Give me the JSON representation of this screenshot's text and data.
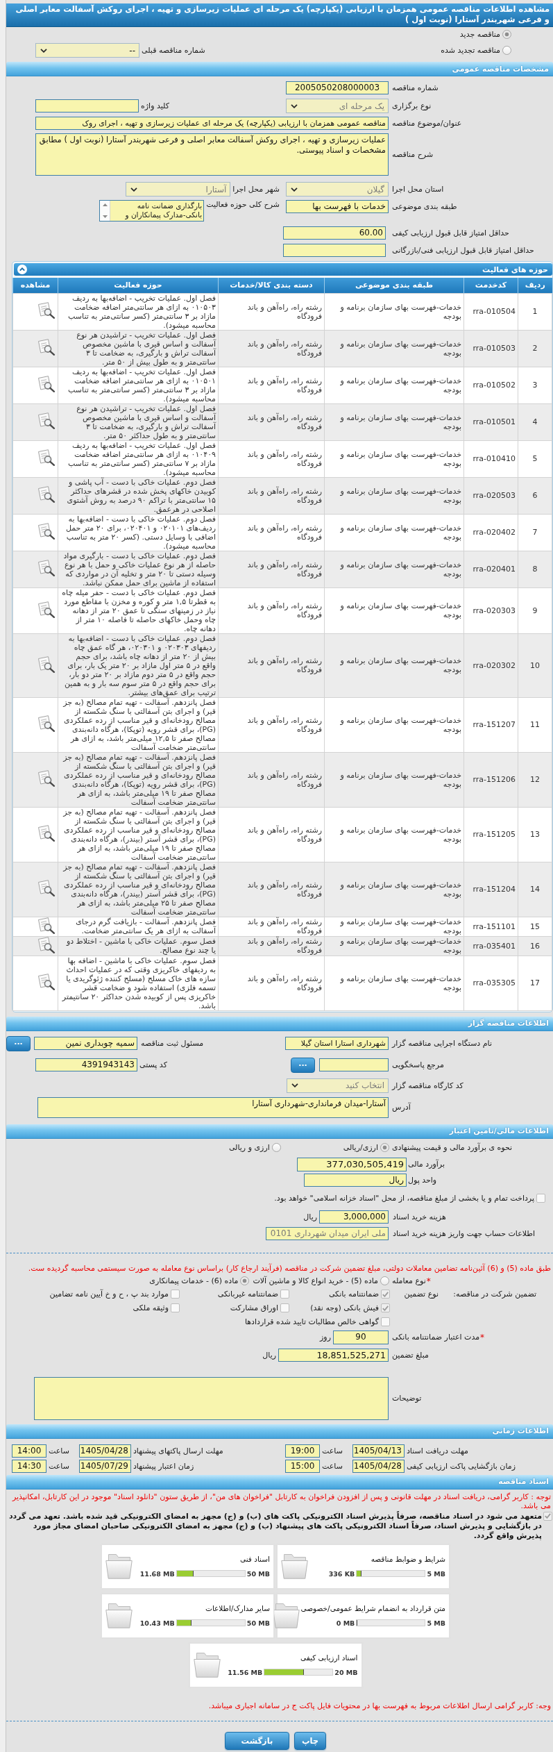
{
  "page_title": "مشاهده اطلاعات مناقصه عمومی همزمان با ارزیابی (یکپارچه) یک مرحله ای عملیات زیرسازی و تهیه ، اجرای روکش آسفالت معابر اصلی و فرعی شهربندر آستارا (نوبت اول )",
  "tender_status": {
    "options": [
      {
        "label": "مناقصه جدید",
        "selected": true
      },
      {
        "label": "مناقصه تجدید شده",
        "selected": false
      }
    ],
    "previous_number": {
      "label": "شماره مناقصه قبلی",
      "value": "--"
    }
  },
  "general": {
    "title": "مشخصات مناقصه عمومی",
    "tender_number": {
      "label": "شماره مناقصه",
      "value": "2005050208000003"
    },
    "holding_type": {
      "label": "نوع برگزاری",
      "value": "یک مرحله ای",
      "disabled": true
    },
    "keyword": {
      "label": "کلید واژه"
    },
    "subject": {
      "label": "عنوان/موضوع مناقصه",
      "value": "مناقصه عمومی همزمان با ارزیابی (یکپارچه) یک مرحله ای عملیات زیرسازی و تهیه ، اجرای روک"
    },
    "description": {
      "label": "شرح مناقصه",
      "value": "عملیات زیرسازی و تهیه ، اجرای روکش آسفالت معابر اصلی و فرعی شهربندر آستارا (نوبت اول ) مطابق مشخصات و اسناد پیوستی."
    },
    "province": {
      "label": "استان محل اجرا",
      "value": "گیلان",
      "disabled": true
    },
    "city": {
      "label": "شهر محل اجرا",
      "value": "آستارا",
      "disabled": true
    },
    "category": {
      "label": "طبقه بندی موضوعی",
      "value": "خدمات با فهرست بها"
    },
    "activity_scope": {
      "label": "شرح کلی حوزه فعالیت",
      "lines": [
        "بارگذاری ضمانت نامه",
        "بانکی-مدارک پیمانکاران و"
      ]
    },
    "min_quality_score": {
      "label": "حداقل امتیاز قابل قبول ارزیابی کیفی",
      "value": "60.00"
    },
    "min_technical_score": {
      "label": "حداقل امتیاز قابل قبول ارزیابی فنی/بازرگانی"
    }
  },
  "activities": {
    "title": "حوزه های فعالیت",
    "expanded": true,
    "columns": [
      "ردیف",
      "کدخدمت",
      "طبقه بندی موضوعی",
      "دسته بندی کالا/خدمات",
      "حوزه فعالیت",
      "مشاهده"
    ],
    "rows": [
      {
        "index": "1",
        "code": "rra-010504",
        "category": "خدمات-فهرست بهای سازمان برنامه و بودجه",
        "group": "رشته راه، راه‌آهن و باند فرودگاه",
        "activity": "فصل اول. عملیات تخریب - اضافه‌بها به ردیف ۰۱۰۵۰۳ به ازای هر سانتی‌متر اضافه ضخامت مازاد بر ۳ سانتی‌متر (کسر سانتی‌متر به تناسب محاسبه میشود)."
      },
      {
        "index": "2",
        "code": "rra-010503",
        "category": "خدمات-فهرست بهای سازمان برنامه و بودجه",
        "group": "رشته راه، راه‌آهن و باند فرودگاه",
        "activity": "فصل اول. عملیات تخریب - تراشیدن هر نوع آسفالت و اساس قیری با ماشین مخصوص آسفالت تراش و بارگیری، به ضخامت تا ۳ سانتی‌متر و به طول بیش از ۵۰ متر."
      },
      {
        "index": "3",
        "code": "rra-010502",
        "category": "خدمات-فهرست بهای سازمان برنامه و بودجه",
        "group": "رشته راه، راه‌آهن و باند فرودگاه",
        "activity": "فصل اول. عملیات تخریب - اضافه‌بها به ردیف ۰۱۰۵۰۱ به ازای هر سانتی‌متر اضافه ضخامت مازاد بر ۳ سانتی‌متر (کسر سانتی‌متر به تناسب محاسبه میشود)."
      },
      {
        "index": "4",
        "code": "rra-010501",
        "category": "خدمات-فهرست بهای سازمان برنامه و بودجه",
        "group": "رشته راه، راه‌آهن و باند فرودگاه",
        "activity": "فصل اول. عملیات تخریب - تراشیدن هر نوع آسفالت و اساس قیری با ماشین مخصوص آسفالت تراش و بارگیری، به ضخامت تا ۳ سانتی‌متر و به طول حداکثر ۵۰ متر."
      },
      {
        "index": "5",
        "code": "rra-010410",
        "category": "خدمات-فهرست بهای سازمان برنامه و بودجه",
        "group": "رشته راه، راه‌آهن و باند فرودگاه",
        "activity": "فصل اول. عملیات تخریب - اضافه‌بها به ردیف ۰۱۰۴۰۹ به ازای هر سانتی‌متر اضافه ضخامت مازاد بر ۷ سانتی‌متر (کسر سانتی‌متر به تناسب محاسبه میشود)."
      },
      {
        "index": "6",
        "code": "rra-020503",
        "category": "خدمات-فهرست بهای سازمان برنامه و بودجه",
        "group": "رشته راه، راه‌آهن و باند فرودگاه",
        "activity": "فصل دوم. عملیات خاکی با دست - آب پاشی و کوبیدن خاکهای پخش شده در قشرهای حداکثر ۱۵ سانتی‌متر با تراکم ۹۰ درصد به روش آشتوی اصلاحی در هرعمق."
      },
      {
        "index": "7",
        "code": "rra-020402",
        "category": "خدمات-فهرست بهای سازمان برنامه و بودجه",
        "group": "رشته راه، راه‌آهن و باند فرودگاه",
        "activity": "فصل دوم. عملیات خاکی با دست - اضافه‌بها به ردیف‌های ۰۲۰۱۰۱ و ۰۲۰۴۰۱، برای ۲۰ متر حمل اضافی با وسایل دستی. (کسر ۲۰ متر به تناسب محاسبه میشود)."
      },
      {
        "index": "8",
        "code": "rra-020401",
        "category": "خدمات-فهرست بهای سازمان برنامه و بودجه",
        "group": "رشته راه، راه‌آهن و باند فرودگاه",
        "activity": "فصل دوم. عملیات خاکی با دست - بارگیری مواد حاصله از هر نوع عملیات خاکی و حمل با هر نوع وسیله دستی تا ۲۰ متر و تخلیه آن در مواردی که استفاده از ماشین برای حمل ممکن نباشد."
      },
      {
        "index": "9",
        "code": "rra-020303",
        "category": "خدمات-فهرست بهای سازمان برنامه و بودجه",
        "group": "رشته راه، راه‌آهن و باند فرودگاه",
        "activity": "فصل دوم. عملیات خاکی با دست - حفر میله چاه به قطرتا ۱,۵ متر و کوره و مخزن با مقاطع مورد نیاز در زمینهای سنگی تا عمق ۲۰ متر از دهانه چاه وحمل خاکهای حاصله تا فاصله ۱۰ متر از دهانه چاه."
      },
      {
        "index": "10",
        "code": "rra-020302",
        "category": "خدمات-فهرست بهای سازمان برنامه و بودجه",
        "group": "رشته راه، راه‌آهن و باند فرودگاه",
        "activity": "فصل دوم. عملیات خاکی با دست - اضافه‌بها به ردیفهای ۰۲۰۳۰۳ و ۰۲۰۳۰۱، هر گاه عمق چاه بیش از ۲۰ متر از دهانه چاه باشد، برای حجم واقع در ۵ متر اول مازاد بر ۲۰ متر یک بار، برای حجم واقع در ۵ متر دوم مازاد بر ۲۰ متر دو بار، برای حجم واقع در ۵ متر سوم سه بار و به همین ترتیب برای عمق‌های بیشتر."
      },
      {
        "index": "11",
        "code": "rra-151207",
        "category": "خدمات-فهرست بهای سازمان برنامه و بودجه",
        "group": "رشته راه، راه‌آهن و باند فرودگاه",
        "activity": "فصل پانزدهم. آسفالت - تهیه تمام مصالح (به جز قیر) و اجرای بتن آسفالتی با سنگ شکسته از مصالح رودخانه‌ای و قیر مناسب از رده عملکردی (PG)، برای قشر رویه (توپکا)، هرگاه دانه‌بندی مصالح صفر تا ۱۲,۵ میلی‌متر باشد، به ازای هر سانتی‌متر ضخامت آسفالت"
      },
      {
        "index": "12",
        "code": "rra-151206",
        "category": "خدمات-فهرست بهای سازمان برنامه و بودجه",
        "group": "رشته راه، راه‌آهن و باند فرودگاه",
        "activity": "فصل پانزدهم. آسفالت - تهیه تمام مصالح (به جز قیر) و اجرای بتن آسفالتی با سنگ شکسته از مصالح رودخانه‌ای و قیر مناسب از رده عملکردی (PG)، برای قشر رویه (توپکا)، هرگاه دانه‌بندی مصالح صفر تا ۱۹ میلی‌متر باشد، به ازای هر سانتی‌متر ضخامت آسفالت"
      },
      {
        "index": "13",
        "code": "rra-151205",
        "category": "خدمات-فهرست بهای سازمان برنامه و بودجه",
        "group": "رشته راه، راه‌آهن و باند فرودگاه",
        "activity": "فصل پانزدهم. آسفالت - تهیه تمام مصالح (به جز قیر) و اجرای بتن آسفالتی با سنگ شکسته از مصالح رودخانه‌ای و قیر مناسب از رده عملکردی (PG)، برای قشر آستر (بیندر)، هرگاه دانه‌بندی مصالح صفر تا ۱۹ میلی‌متر باشد، به ازای هر سانتی‌متر ضخامت آسفالت"
      },
      {
        "index": "14",
        "code": "rra-151204",
        "category": "خدمات-فهرست بهای سازمان برنامه و بودجه",
        "group": "رشته راه، راه‌آهن و باند فرودگاه",
        "activity": "فصل پانزدهم. آسفالت - تهیه تمام مصالح (به جز قیر) و اجرای بتن آسفالتی با سنگ شکسته از مصالح رودخانه‌ای و قیر مناسب از رده عملکردی (PG)، برای قشر آستر (بیندر)، هرگاه دانه‌بندی مصالح صفر تا ۲۵ میلی‌متر باشد، به ازای هر سانتی‌متر ضخامت آسفالت"
      },
      {
        "index": "15",
        "code": "rra-151101",
        "category": "خدمات-فهرست بهای سازمان برنامه و بودجه",
        "group": "رشته راه، راه‌آهن و باند فرودگاه",
        "activity": "فصل پانزدهم. آسفالت - بازیافت گرم درجای آسفالت به ازای هر یک سانتی‌متر ضخامت."
      },
      {
        "index": "16",
        "code": "rra-035401",
        "category": "خدمات-فهرست بهای سازمان برنامه و بودجه",
        "group": "رشته راه، راه‌آهن و باند فرودگاه",
        "activity": "فصل سوم. عملیات خاکی با ماشین - اختلاط دو یا چند نوع مصالح."
      },
      {
        "index": "17",
        "code": "rra-035305",
        "category": "خدمات-فهرست بهای سازمان برنامه و بودجه",
        "group": "رشته راه، راه‌آهن و باند فرودگاه",
        "activity": "فصل سوم. عملیات خاکی با ماشین - اضافه بها به ردیفهای خاکریزی وقتی که در عملیات احداث سازه های خاک مسلح (مسلح کننده ژئوگریدی یا تسمه فلزی) استفاده شود و ضخامت قشر خاکریزی پس از کوبیده شدن حداکثر ۲۰ سانتیمتر باشد."
      }
    ]
  },
  "organizer": {
    "title": "اطلاعات مناقصه گزار",
    "agency": {
      "label": "نام دستگاه اجرایی مناقصه گزار",
      "value": "شهرداری استارا استان گیلا"
    },
    "registrar": {
      "label": "مسئول ثبت مناقصه",
      "value": "سمیه چوبداری نمین",
      "button": "..."
    },
    "responder": {
      "label": "مرجع پاسخگویی",
      "button": "..."
    },
    "postal_code": {
      "label": "کد پستی",
      "value": "4391943143"
    },
    "workshop_code": {
      "label": "کد کارگاه مناقصه گزار",
      "placeholder": "انتخاب کنید"
    },
    "address": {
      "label": "آدرس",
      "value": "آستارا-میدان فرمانداری-شهرداری آستارا"
    }
  },
  "finance": {
    "title": "اطلاعات مالی/تامین اعتبار",
    "estimate_method": {
      "label": "نحوه ی برآورد مالی و قیمت پیشنهادی",
      "options": [
        {
          "label": "ارزی/ریالی",
          "selected": true
        },
        {
          "label": "ارزی و ریالی",
          "selected": false
        }
      ]
    },
    "estimate": {
      "label": "برآورد مالی",
      "value": "377,030,505,419"
    },
    "currency": {
      "label": "واحد پول",
      "value": "ریال"
    },
    "treasury": {
      "label": "پرداخت تمام و یا بخشی از مبلغ مناقصه، از محل \"اسناد خزانه اسلامی\" خواهد بود.",
      "checked": false
    },
    "document_fee": {
      "label": "هزینه خرید اسناد",
      "value": "3,000,000",
      "unit": "ریال"
    },
    "account": {
      "label": "اطلاعات حساب جهت واریز هزینه خرید اسناد",
      "value": "ملی ایران میدان شهرداری 0101",
      "disabled": true
    }
  },
  "guarantee": {
    "notice": "طبق ماده (5) و (6) آئین‌نامه تضامین معاملات دولتی، مبلغ تضمین شرکت در مناقصه (فرآیند ارجاع کار) براساس نوع معامله به صورت سیستمی محاسبه گردیده ست.",
    "deal_type": {
      "required_mark": "*",
      "label": "نوع معامله",
      "options": [
        {
          "label": "ماده (5) - خرید انواع کالا و ماشین آلات",
          "selected": false
        },
        {
          "label": "ماده (6) - خدمات پیمانکاری",
          "selected": true
        }
      ]
    },
    "participation_label": "تضمین شرکت در مناقصه:",
    "type_label": "نوع تضمین",
    "types": [
      {
        "label": "ضمانتنامه بانکی",
        "checked": true
      },
      {
        "label": "ضمانتنامه غیربانکی",
        "checked": false
      },
      {
        "label": "موارد بند پ ، ح و خ آیین نامه تضامین",
        "checked": false
      },
      {
        "label": "فیش بانکی (وجه نقد)",
        "checked": true
      },
      {
        "label": "اوراق مشارکت",
        "checked": false
      },
      {
        "label": "وثیقه ملکی",
        "checked": false
      },
      {
        "label": "گواهی خالص مطالبات تایید شده قراردادها",
        "checked": false
      }
    ],
    "validity": {
      "required_mark": "*",
      "label": "مدت اعتبار ضمانتنامه بانکی",
      "value": "90",
      "unit": "روز"
    },
    "amount": {
      "label": "مبلغ تضمین",
      "value": "18,851,525,271",
      "unit": "ریال"
    },
    "notes": {
      "label": "توضیحات"
    }
  },
  "schedule": {
    "title": "اطلاعات زمانی",
    "items": [
      {
        "label": "مهلت دریافت اسناد",
        "date": "1405/04/13",
        "time_label": "ساعت",
        "time": "19:00"
      },
      {
        "label": "مهلت ارسال پاکتهای پیشنهاد",
        "date": "1405/04/28",
        "time_label": "ساعت",
        "time": "14:00"
      },
      {
        "label": "زمان بازگشایی پاکت ارزیابی کیفی",
        "date": "1405/04/28",
        "time_label": "ساعت",
        "time": "15:00"
      },
      {
        "label": "زمان اعتبار پیشنهاد",
        "date": "1405/07/29",
        "time_label": "ساعت",
        "time": "14:30"
      }
    ]
  },
  "documents": {
    "title": "اسناد مناقصه",
    "notice": "توجه : کاربر گرامی، دریافت اسناد در مهلت قانونی و پس از افزودن فراخوان به کارتابل \"فراخوان های من\"، از طریق ستون \"دانلود اسناد\" موجود در این کارتابل، امکانپذیر می باشد.",
    "commitment": {
      "text": "متعهد می شود در اسناد مناقصه، صرفاً پذیرش اسناد الکترونیکی پاکت های (ب) و (ج) مجهز به امضای الکترونیکی قید شده باشد. تعهد می گردد در بازگشایی و پذیرش اسناد، صرفاً اسناد الکترونیکی پاکت های پیشنهاد (ب) و (ج) مجهز به امضای الکترونیکی صاحبان امضای مجاز مورد پذیرش واقع گردد.",
      "checked": true
    },
    "files": [
      {
        "name": "شرایط و ضوابط مناقصه",
        "size": "336 KB",
        "limit": "5 MB",
        "level": 0.07
      },
      {
        "name": "اسناد فنی",
        "size": "11.68 MB",
        "limit": "50 MB",
        "level": 0.25
      },
      {
        "name": "متن قرارداد به انضمام شرایط عمومی/خصوصی",
        "size": "0 MB",
        "limit": "5 MB",
        "level": 0
      },
      {
        "name": "سایر مدارک/اطلاعات",
        "size": "10.43 MB",
        "limit": "50 MB",
        "level": 0.22
      },
      {
        "name": "اسناد ارزیابی کیفی",
        "size": "11.56 MB",
        "limit": "20 MB",
        "level": 0.58
      }
    ],
    "footer_notice": "وجه: کاربر گرامی ارسال اطلاعات مربوط به فهرست بها در محتویات فایل پاکت ج در سامانه اجباری میباشد."
  },
  "actions": [
    "چاپ",
    "بازگشت"
  ]
}
